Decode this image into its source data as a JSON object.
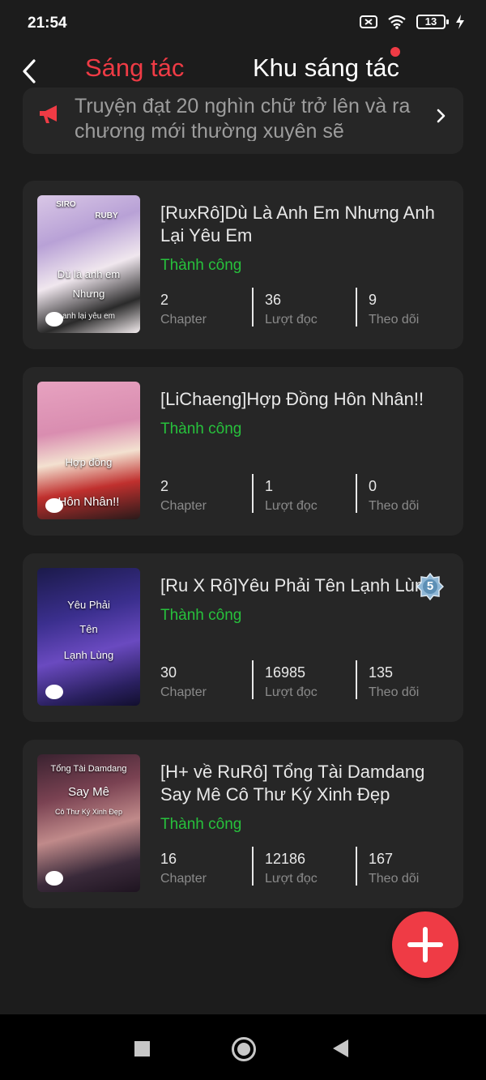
{
  "status_bar": {
    "time": "21:54",
    "battery": "13"
  },
  "header": {
    "tabs": [
      {
        "label": "Sáng tác",
        "active": true
      },
      {
        "label": "Khu sáng tác",
        "active": false,
        "has_notification": true
      }
    ]
  },
  "notice": {
    "text": "Truyện đạt 20 nghìn chữ trở lên và ra chương mới thường xuyên sẽ"
  },
  "stories": [
    {
      "title": "[RuxRô]Dù Là Anh Em Nhưng Anh Lại Yêu Em",
      "status": "Thành công",
      "chapters": "2",
      "chapters_label": "Chapter",
      "reads": "36",
      "reads_label": "Lượt đọc",
      "follows": "9",
      "follows_label": "Theo dõi",
      "cover_text": [
        "SIRO",
        "RUBY",
        "Dù là anh em",
        "Nhưng",
        "anh lại yêu em"
      ]
    },
    {
      "title": "[LiChaeng]Hợp Đồng Hôn Nhân!!",
      "status": "Thành công",
      "chapters": "2",
      "chapters_label": "Chapter",
      "reads": "1",
      "reads_label": "Lượt đọc",
      "follows": "0",
      "follows_label": "Theo dõi",
      "cover_text": [
        "Hợp đồng",
        "Hôn Nhân!!"
      ]
    },
    {
      "title": "[Ru X Rô]Yêu Phải Tên Lạnh Lùng",
      "status": "Thành công",
      "chapters": "30",
      "chapters_label": "Chapter",
      "reads": "16985",
      "reads_label": "Lượt đọc",
      "follows": "135",
      "follows_label": "Theo dõi",
      "badge": "5",
      "cover_text": [
        "Yêu Phải",
        "Tên",
        "Lạnh Lùng"
      ]
    },
    {
      "title": "[H+ về RuRô] Tổng Tài Damdang Say Mê Cô Thư Ký Xinh Đẹp",
      "status": "Thành công",
      "chapters": "16",
      "chapters_label": "Chapter",
      "reads": "12186",
      "reads_label": "Lượt đọc",
      "follows": "167",
      "follows_label": "Theo dõi",
      "cover_text": [
        "Tổng Tài Damdang",
        "Say Mê",
        "Cô Thư Ký Xinh Đẹp"
      ]
    }
  ],
  "colors": {
    "accent": "#ef3b45",
    "success": "#27c13c",
    "card": "#262626",
    "background": "#1c1c1c"
  },
  "icons": [
    "back-arrow-icon",
    "megaphone-icon",
    "chevron-right-icon",
    "comment-bubble-icon",
    "plus-icon",
    "level-badge-icon"
  ]
}
